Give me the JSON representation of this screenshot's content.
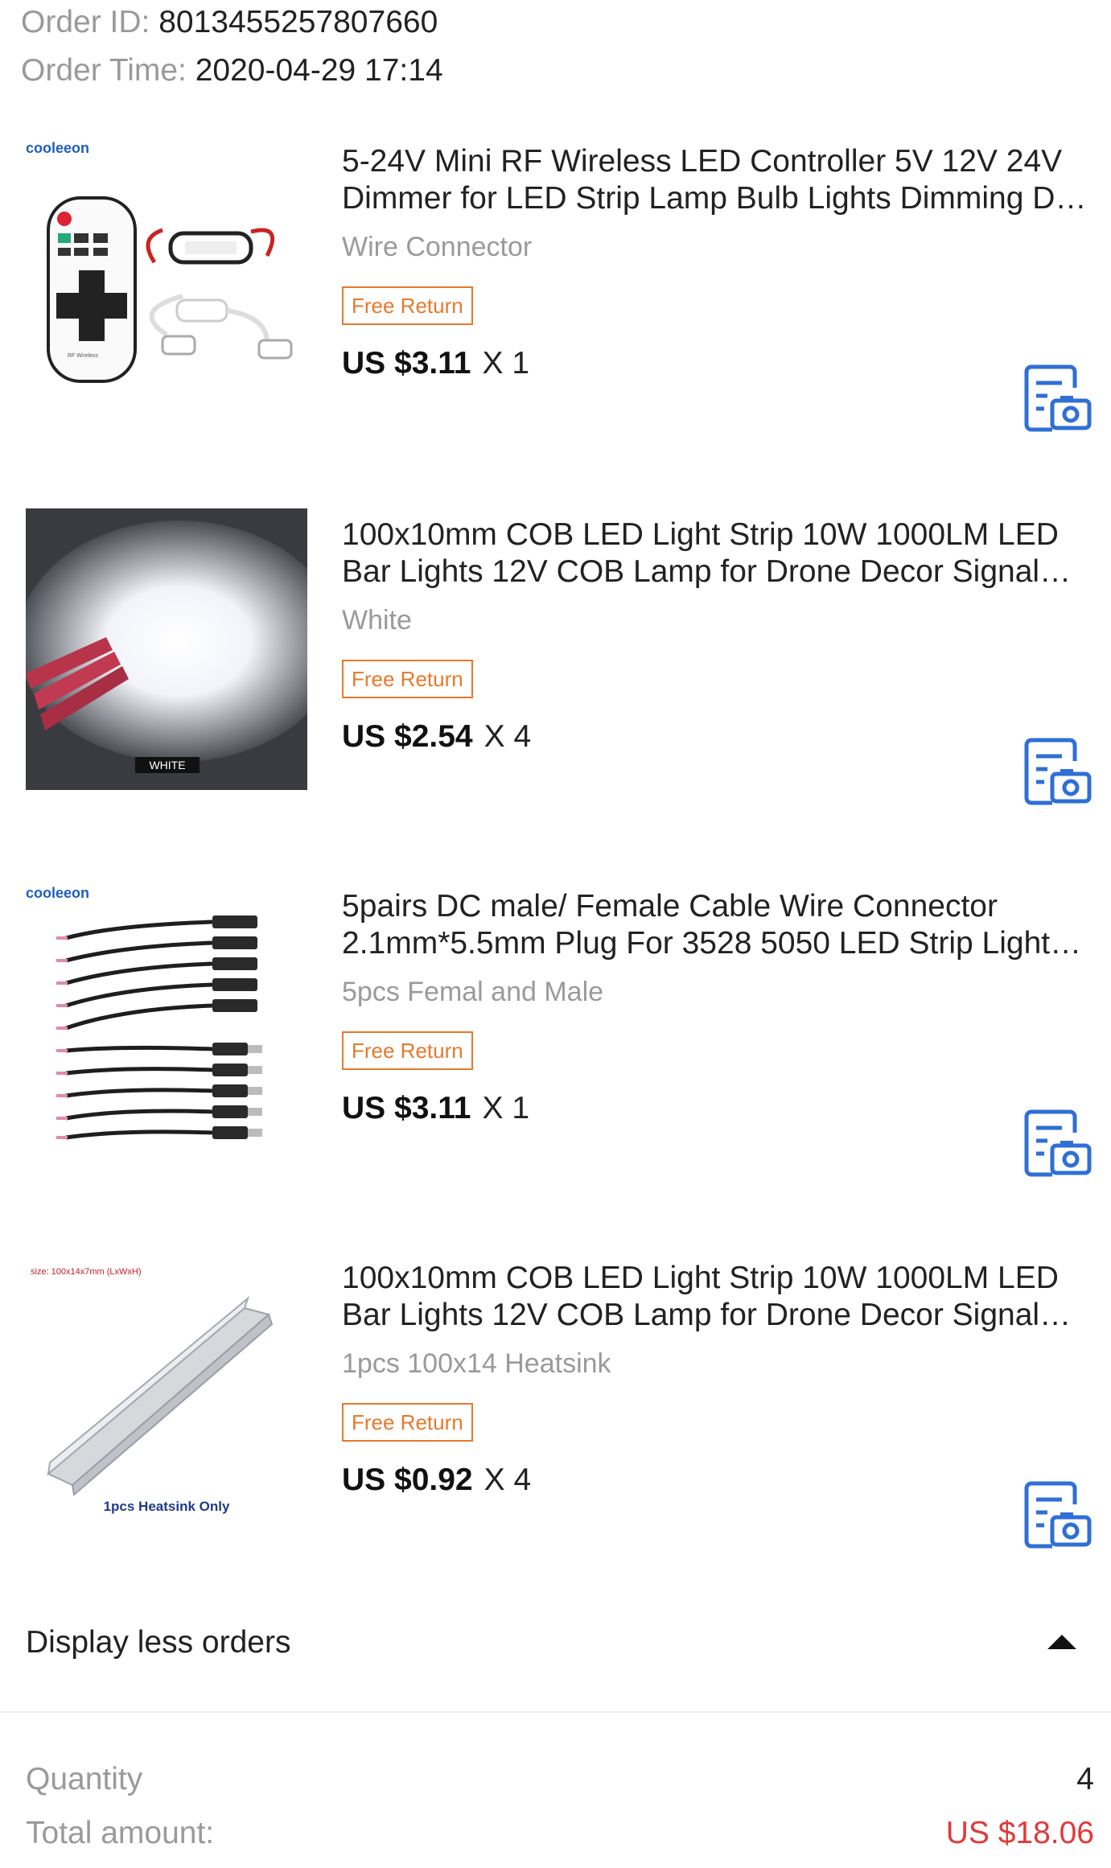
{
  "order": {
    "id_label": "Order ID:",
    "id_value": "8013455257807660",
    "time_label": "Order Time:",
    "time_value": "2020-04-29 17:14"
  },
  "items": [
    {
      "title": "5-24V Mini RF Wireless LED Controller 5V 12V 24V Dimmer for LED Strip Lamp Bulb Lights Dimming DC Connector",
      "variant": "Wire Connector",
      "badge": "Free Return",
      "price": "US $3.11",
      "qty": "X 1",
      "image_brand": "cooleeon",
      "image_caption": "RF Wireless"
    },
    {
      "title": "100x10mm COB LED Light Strip 10W 1000LM LED Bar Lights 12V COB Lamp for Drone Decor Signal Lights",
      "variant": "White",
      "badge": "Free Return",
      "price": "US $2.54",
      "qty": "X 4",
      "image_caption": "WHITE"
    },
    {
      "title": "5pairs DC male/ Female Cable Wire Connector 2.1mm*5.5mm Plug For 3528 5050 LED Strip Light CCTV Camera",
      "variant": "5pcs Femal and Male",
      "badge": "Free Return",
      "price": "US $3.11",
      "qty": "X 1",
      "image_brand": "cooleeon"
    },
    {
      "title": "100x10mm COB LED Light Strip 10W 1000LM LED Bar Lights 12V COB Lamp for Drone Decor Signal Lights",
      "variant": "1pcs 100x14 Heatsink",
      "badge": "Free Return",
      "price": "US $0.92",
      "qty": "X 4",
      "image_size_label": "size: 100x14x7mm (LxWxH)",
      "image_caption": "1pcs Heatsink Only"
    }
  ],
  "toggle": {
    "label": "Display less orders"
  },
  "summary": {
    "quantity_label": "Quantity",
    "quantity_value": "4",
    "total_label": "Total amount:",
    "total_value": "US $18.06"
  },
  "colors": {
    "accent_orange": "#e8792b",
    "price_red": "#e2393b",
    "icon_blue": "#2f6fd6"
  },
  "icons": {
    "item_action": "photo-review-icon",
    "toggle": "caret-up-icon"
  }
}
